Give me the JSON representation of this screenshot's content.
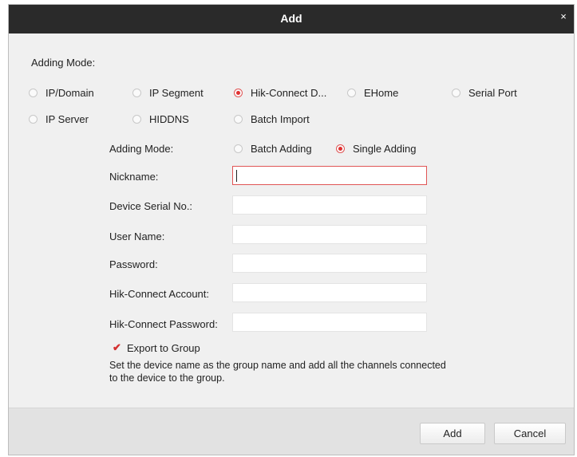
{
  "dialog": {
    "title": "Add",
    "close_glyph": "×"
  },
  "adding_mode_label": "Adding Mode:",
  "modes": [
    {
      "label": "IP/Domain",
      "selected": false
    },
    {
      "label": "IP Segment",
      "selected": false
    },
    {
      "label": "Hik-Connect D...",
      "selected": true
    },
    {
      "label": "EHome",
      "selected": false
    },
    {
      "label": "Serial Port",
      "selected": false
    },
    {
      "label": "IP Server",
      "selected": false
    },
    {
      "label": "HIDDNS",
      "selected": false
    },
    {
      "label": "Batch Import",
      "selected": false
    }
  ],
  "sub_mode": {
    "label": "Adding Mode:",
    "options": [
      {
        "label": "Batch Adding",
        "selected": false
      },
      {
        "label": "Single Adding",
        "selected": true
      }
    ]
  },
  "fields": {
    "nickname": {
      "label": "Nickname:",
      "value": ""
    },
    "serial": {
      "label": "Device Serial No.:",
      "value": ""
    },
    "username": {
      "label": "User Name:",
      "value": ""
    },
    "password": {
      "label": "Password:",
      "value": ""
    },
    "hc_account": {
      "label": "Hik-Connect Account:",
      "value": ""
    },
    "hc_password": {
      "label": "Hik-Connect Password:",
      "value": ""
    }
  },
  "export_group": {
    "label": "Export to Group",
    "checked": true,
    "check_glyph": "✔"
  },
  "hint": "Set the device name as the group name and add all the channels connected to the device to the group.",
  "buttons": {
    "add": "Add",
    "cancel": "Cancel"
  },
  "colors": {
    "titlebar": "#2a2a2a",
    "accent_red": "#e03030",
    "dialog_bg": "#f0f0f0",
    "footer_bg": "#e2e2e2"
  },
  "icons": {
    "close": "close-icon",
    "check": "checkmark-icon",
    "radio_on": "radio-selected-icon",
    "radio_off": "radio-unselected-icon"
  }
}
